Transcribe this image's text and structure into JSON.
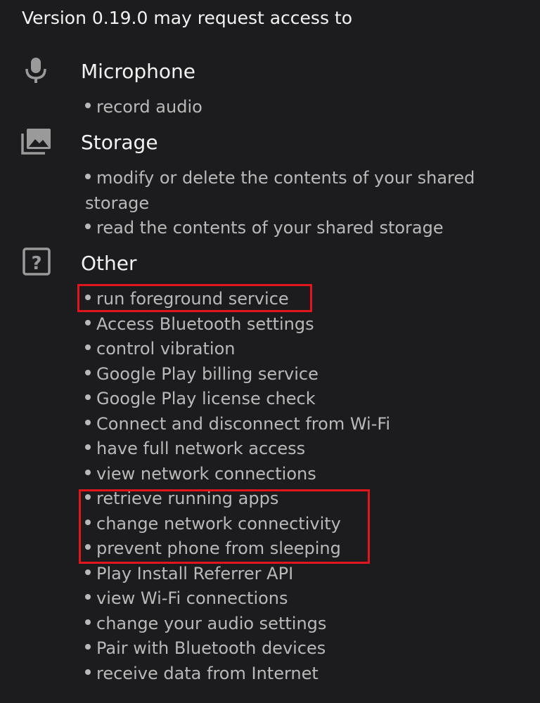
{
  "header": {
    "text": "Version 0.19.0 may request access to"
  },
  "groups": [
    {
      "title": "Microphone",
      "icon": "microphone-icon",
      "permissions": [
        "record audio"
      ]
    },
    {
      "title": "Storage",
      "icon": "photo-stack-icon",
      "permissions": [
        "modify or delete the contents of your shared storage",
        "read the contents of your shared storage"
      ]
    },
    {
      "title": "Other",
      "icon": "question-box-icon",
      "permissions": [
        "run foreground service",
        "Access Bluetooth settings",
        "control vibration",
        "Google Play billing service",
        "Google Play license check",
        "Connect and disconnect from Wi-Fi",
        "have full network access",
        "view network connections",
        "retrieve running apps",
        "change network connectivity",
        "prevent phone from sleeping",
        "Play Install Referrer API",
        "view Wi-Fi connections",
        "change your audio settings",
        "Pair with Bluetooth devices",
        "receive data from Internet"
      ]
    }
  ],
  "colors": {
    "background": "#1c1c1e",
    "title_text": "#f2f2f2",
    "permission_text": "#b9b9b9",
    "icon": "#9a9a9a",
    "highlight": "#e0161c"
  }
}
